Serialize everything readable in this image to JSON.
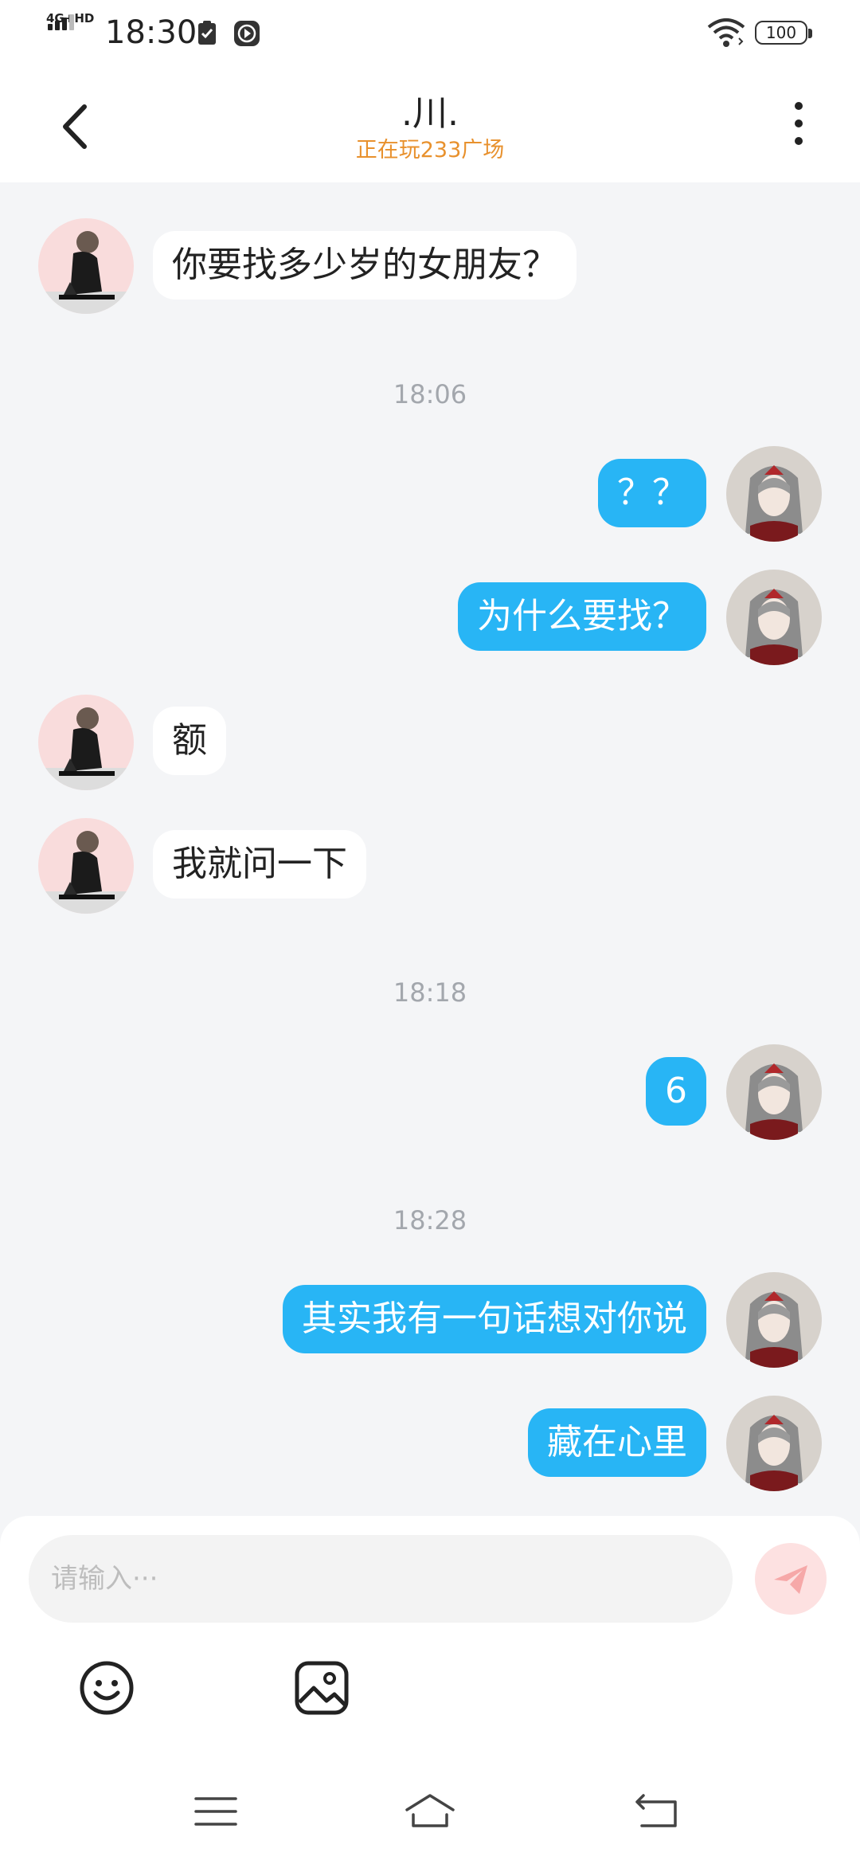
{
  "status_bar": {
    "network": "4G+HD",
    "time": "18:30",
    "battery": "100"
  },
  "header": {
    "title": ".川.",
    "subtitle": "正在玩233广场"
  },
  "messages": [
    {
      "from": "other",
      "text": "你要找多少岁的女朋友？"
    },
    {
      "type": "timestamp",
      "text": "18:06"
    },
    {
      "from": "me",
      "text": "？？"
    },
    {
      "from": "me",
      "text": "为什么要找？"
    },
    {
      "from": "other",
      "text": "额"
    },
    {
      "from": "other",
      "text": "我就问一下"
    },
    {
      "type": "timestamp",
      "text": "18:18"
    },
    {
      "from": "me",
      "text": "6"
    },
    {
      "type": "timestamp",
      "text": "18:28"
    },
    {
      "from": "me",
      "text": "其实我有一句话想对你说"
    },
    {
      "from": "me",
      "text": "藏在心里"
    }
  ],
  "composer": {
    "placeholder": "请输入···"
  },
  "icons": {
    "back": "back-arrow-icon",
    "more": "more-vertical-icon",
    "emoji": "emoji-icon",
    "image": "image-icon",
    "send": "send-plane-icon",
    "nav_menu": "menu-icon",
    "nav_home": "home-icon",
    "nav_back": "back-nav-icon"
  },
  "colors": {
    "accent": "#28B5F5",
    "subtitle": "#E8912D",
    "background": "#F4F5F7"
  }
}
